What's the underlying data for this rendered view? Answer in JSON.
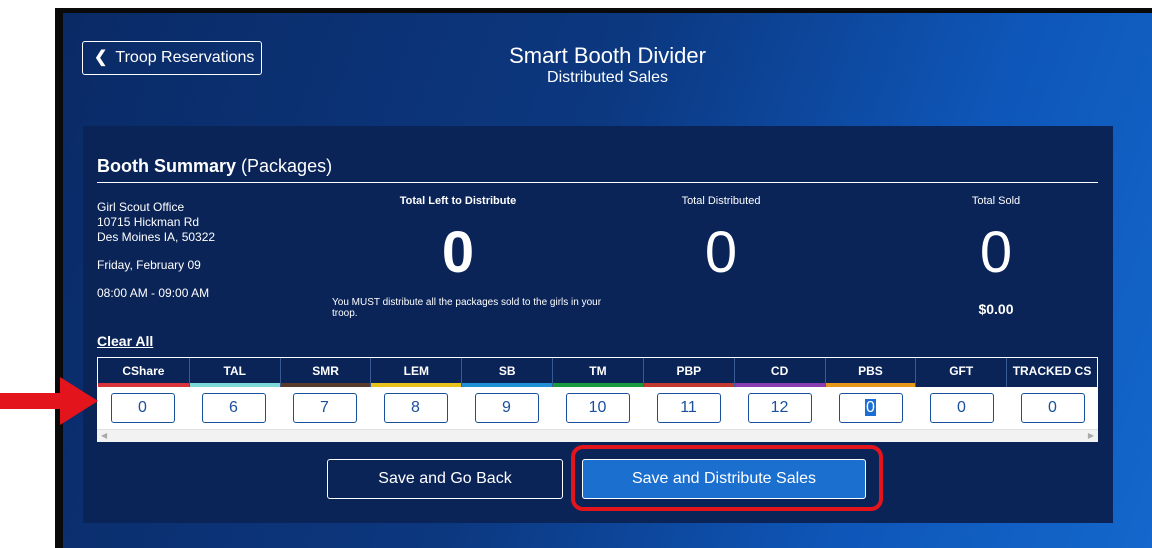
{
  "header": {
    "back_label": "Troop Reservations",
    "title": "Smart Booth Divider",
    "subtitle": "Distributed Sales"
  },
  "summary": {
    "heading_bold": "Booth Summary",
    "heading_rest": " (Packages)",
    "location_name": "Girl Scout Office",
    "address_line1": "10715 Hickman Rd",
    "address_line2": "Des Moines IA, 50322",
    "date": "Friday, February 09",
    "time": "08:00 AM - 09:00 AM",
    "left_label": "Total Left to Distribute",
    "left_value": "0",
    "distributed_label": "Total Distributed",
    "distributed_value": "0",
    "sold_label": "Total Sold",
    "sold_value": "0",
    "sold_amount": "$0.00",
    "note": "You MUST distribute all the packages sold to the girls in your troop."
  },
  "clear_all_label": "Clear All",
  "columns": [
    {
      "label": "CShare",
      "color": "#d9343c",
      "value": "0"
    },
    {
      "label": "TAL",
      "color": "#7fd8d8",
      "value": "6"
    },
    {
      "label": "SMR",
      "color": "#5a3a2a",
      "value": "7"
    },
    {
      "label": "LEM",
      "color": "#e8c21a",
      "value": "8"
    },
    {
      "label": "SB",
      "color": "#1f8fd6",
      "value": "9"
    },
    {
      "label": "TM",
      "color": "#1a9a3e",
      "value": "10"
    },
    {
      "label": "PBP",
      "color": "#c23a2f",
      "value": "11"
    },
    {
      "label": "CD",
      "color": "#8a3db0",
      "value": "12"
    },
    {
      "label": "PBS",
      "color": "#e8961a",
      "value": "0"
    },
    {
      "label": "GFT",
      "color": "#0a2458",
      "value": "0"
    },
    {
      "label": "TRACKED CS",
      "color": "#0a2458",
      "value": "0"
    }
  ],
  "actions": {
    "go_back_label": "Save and Go Back",
    "distribute_label": "Save and Distribute Sales"
  },
  "annotation_colors": {
    "arrow": "#e3141c",
    "highlight": "#e3141c"
  }
}
